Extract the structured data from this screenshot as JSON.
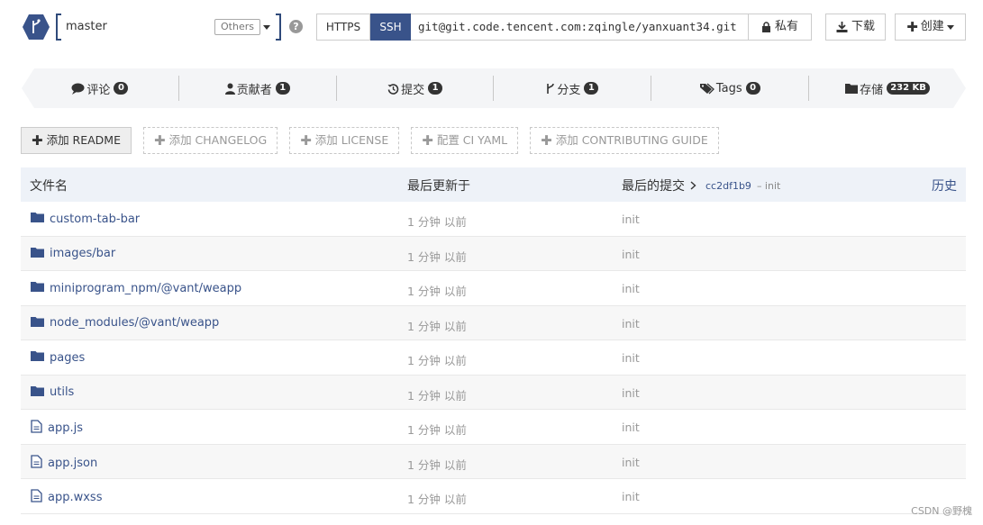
{
  "branch": {
    "value": "master",
    "others_label": "Others"
  },
  "clone": {
    "https_label": "HTTPS",
    "ssh_label": "SSH",
    "url": "git@git.code.tencent.com:zqingle/yanxuant34.git",
    "private_label": "私有"
  },
  "actions": {
    "download_label": "下载",
    "create_label": "创建"
  },
  "stats": [
    {
      "label": "评论",
      "count": "0",
      "icon": "comment-icon"
    },
    {
      "label": "贡献者",
      "count": "1",
      "icon": "user-icon"
    },
    {
      "label": "提交",
      "count": "1",
      "icon": "history-icon"
    },
    {
      "label": "分支",
      "count": "1",
      "icon": "branch-icon"
    },
    {
      "label": "Tags",
      "count": "0",
      "icon": "tags-icon"
    },
    {
      "label": "存储",
      "count": "232 KB",
      "icon": "folder-icon"
    }
  ],
  "add_buttons": [
    {
      "label": "添加 README",
      "primary": true
    },
    {
      "label": "添加 CHANGELOG",
      "primary": false
    },
    {
      "label": "添加 LICENSE",
      "primary": false
    },
    {
      "label": "配置 CI YAML",
      "primary": false
    },
    {
      "label": "添加 CONTRIBUTING GUIDE",
      "primary": false
    }
  ],
  "table": {
    "col_name": "文件名",
    "col_updated": "最后更新于",
    "col_commit": "最后的提交",
    "commit_sha": "cc2df1b9",
    "commit_msg": "– init",
    "history_label": "历史",
    "rows": [
      {
        "name": "custom-tab-bar",
        "type": "folder",
        "time": "1 分钟 以前",
        "msg": "init"
      },
      {
        "name": "images/bar",
        "type": "folder",
        "time": "1 分钟 以前",
        "msg": "init"
      },
      {
        "name": "miniprogram_npm/@vant/weapp",
        "type": "folder",
        "time": "1 分钟 以前",
        "msg": "init"
      },
      {
        "name": "node_modules/@vant/weapp",
        "type": "folder",
        "time": "1 分钟 以前",
        "msg": "init"
      },
      {
        "name": "pages",
        "type": "folder",
        "time": "1 分钟 以前",
        "msg": "init"
      },
      {
        "name": "utils",
        "type": "folder",
        "time": "1 分钟 以前",
        "msg": "init"
      },
      {
        "name": "app.js",
        "type": "file",
        "time": "1 分钟 以前",
        "msg": "init"
      },
      {
        "name": "app.json",
        "type": "file",
        "time": "1 分钟 以前",
        "msg": "init"
      },
      {
        "name": "app.wxss",
        "type": "file",
        "time": "1 分钟 以前",
        "msg": "init"
      }
    ]
  },
  "watermark": "CSDN @野槐",
  "colors": {
    "accent": "#39538a",
    "ssh_bg": "#39538a",
    "header_bg": "#eef2f8"
  }
}
